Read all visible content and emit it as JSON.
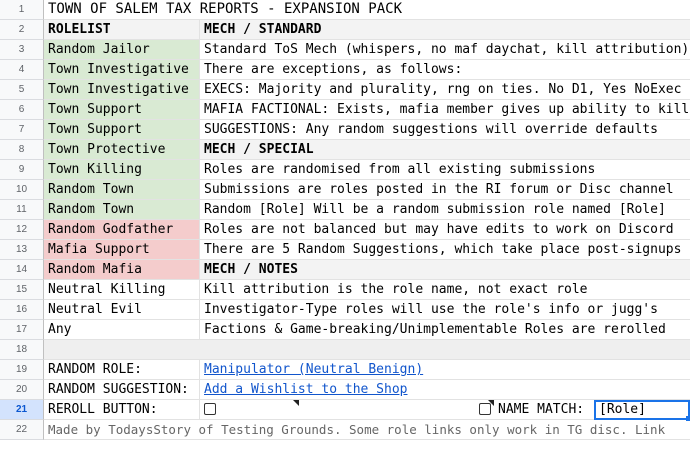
{
  "title": "TOWN OF SALEM TAX REPORTS - EXPANSION PACK",
  "rows": [
    {
      "num": "1"
    },
    {
      "num": "2",
      "a": "ROLELIST",
      "b": "MECH / STANDARD"
    },
    {
      "num": "3",
      "a": "Random Jailor",
      "b": "Standard ToS Mech (whispers, no maf daychat, kill attribution)"
    },
    {
      "num": "4",
      "a": "Town Investigative",
      "b": "There are exceptions, as follows:"
    },
    {
      "num": "5",
      "a": "Town Investigative",
      "b": "EXECS: Majority and plurality, rng on ties. No D1, Yes NoExec"
    },
    {
      "num": "6",
      "a": "Town Support",
      "b": "MAFIA FACTIONAL: Exists, mafia member gives up ability to kill"
    },
    {
      "num": "7",
      "a": "Town Support",
      "b": "SUGGESTIONS: Any random suggestions will override defaults"
    },
    {
      "num": "8",
      "a": "Town Protective",
      "b": "MECH / SPECIAL"
    },
    {
      "num": "9",
      "a": "Town Killing",
      "b": "Roles are randomised from all existing submissions"
    },
    {
      "num": "10",
      "a": "Random Town",
      "b": "Submissions are roles posted in the RI forum or Disc channel"
    },
    {
      "num": "11",
      "a": "Random Town",
      "b": "Random [Role] Will be a random submission role named [Role]"
    },
    {
      "num": "12",
      "a": "Random Godfather",
      "b": "Roles are not balanced but may have edits to work on Discord"
    },
    {
      "num": "13",
      "a": "Mafia Support",
      "b": "There are 5 Random Suggestions, which take place post-signups"
    },
    {
      "num": "14",
      "a": "Random Mafia",
      "b": "MECH / NOTES"
    },
    {
      "num": "15",
      "a": "Neutral Killing",
      "b": "Kill attribution is the role name, not exact role"
    },
    {
      "num": "16",
      "a": "Neutral Evil",
      "b": "Investigator-Type roles will use the role's info or jugg's"
    },
    {
      "num": "17",
      "a": "Any",
      "b": "Factions & Game-breaking/Unimplementable Roles are rerolled"
    },
    {
      "num": "18"
    },
    {
      "num": "19",
      "a": "RANDOM ROLE:",
      "b": "Manipulator (Neutral Benign)"
    },
    {
      "num": "20",
      "a": "RANDOM SUGGESTION:",
      "b": "Add a Wishlist to the Shop"
    },
    {
      "num": "21",
      "a": "REROLL BUTTON:",
      "name_match_label": "NAME MATCH:",
      "name_match_value": "[Role]"
    },
    {
      "num": "22",
      "footer": "Made by TodaysStory of Testing Grounds. Some role links only work in TG disc. Link"
    }
  ],
  "colors": {
    "town": "#d9ead3",
    "mafia": "#f4cccc",
    "header": "#f3f3f3",
    "link": "#1155cc",
    "selected": "#1a73e8"
  }
}
